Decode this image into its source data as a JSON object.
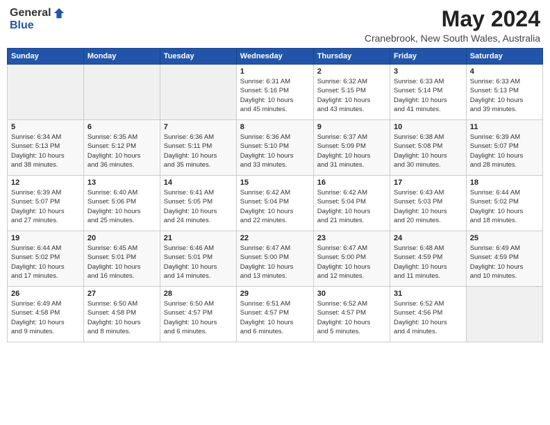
{
  "header": {
    "logo_general": "General",
    "logo_blue": "Blue",
    "month_title": "May 2024",
    "location": "Cranebrook, New South Wales, Australia"
  },
  "days_of_week": [
    "Sunday",
    "Monday",
    "Tuesday",
    "Wednesday",
    "Thursday",
    "Friday",
    "Saturday"
  ],
  "weeks": [
    [
      {
        "day": "",
        "info": ""
      },
      {
        "day": "",
        "info": ""
      },
      {
        "day": "",
        "info": ""
      },
      {
        "day": "1",
        "info": "Sunrise: 6:31 AM\nSunset: 5:16 PM\nDaylight: 10 hours\nand 45 minutes."
      },
      {
        "day": "2",
        "info": "Sunrise: 6:32 AM\nSunset: 5:15 PM\nDaylight: 10 hours\nand 43 minutes."
      },
      {
        "day": "3",
        "info": "Sunrise: 6:33 AM\nSunset: 5:14 PM\nDaylight: 10 hours\nand 41 minutes."
      },
      {
        "day": "4",
        "info": "Sunrise: 6:33 AM\nSunset: 5:13 PM\nDaylight: 10 hours\nand 39 minutes."
      }
    ],
    [
      {
        "day": "5",
        "info": "Sunrise: 6:34 AM\nSunset: 5:13 PM\nDaylight: 10 hours\nand 38 minutes."
      },
      {
        "day": "6",
        "info": "Sunrise: 6:35 AM\nSunset: 5:12 PM\nDaylight: 10 hours\nand 36 minutes."
      },
      {
        "day": "7",
        "info": "Sunrise: 6:36 AM\nSunset: 5:11 PM\nDaylight: 10 hours\nand 35 minutes."
      },
      {
        "day": "8",
        "info": "Sunrise: 6:36 AM\nSunset: 5:10 PM\nDaylight: 10 hours\nand 33 minutes."
      },
      {
        "day": "9",
        "info": "Sunrise: 6:37 AM\nSunset: 5:09 PM\nDaylight: 10 hours\nand 31 minutes."
      },
      {
        "day": "10",
        "info": "Sunrise: 6:38 AM\nSunset: 5:08 PM\nDaylight: 10 hours\nand 30 minutes."
      },
      {
        "day": "11",
        "info": "Sunrise: 6:39 AM\nSunset: 5:07 PM\nDaylight: 10 hours\nand 28 minutes."
      }
    ],
    [
      {
        "day": "12",
        "info": "Sunrise: 6:39 AM\nSunset: 5:07 PM\nDaylight: 10 hours\nand 27 minutes."
      },
      {
        "day": "13",
        "info": "Sunrise: 6:40 AM\nSunset: 5:06 PM\nDaylight: 10 hours\nand 25 minutes."
      },
      {
        "day": "14",
        "info": "Sunrise: 6:41 AM\nSunset: 5:05 PM\nDaylight: 10 hours\nand 24 minutes."
      },
      {
        "day": "15",
        "info": "Sunrise: 6:42 AM\nSunset: 5:04 PM\nDaylight: 10 hours\nand 22 minutes."
      },
      {
        "day": "16",
        "info": "Sunrise: 6:42 AM\nSunset: 5:04 PM\nDaylight: 10 hours\nand 21 minutes."
      },
      {
        "day": "17",
        "info": "Sunrise: 6:43 AM\nSunset: 5:03 PM\nDaylight: 10 hours\nand 20 minutes."
      },
      {
        "day": "18",
        "info": "Sunrise: 6:44 AM\nSunset: 5:02 PM\nDaylight: 10 hours\nand 18 minutes."
      }
    ],
    [
      {
        "day": "19",
        "info": "Sunrise: 6:44 AM\nSunset: 5:02 PM\nDaylight: 10 hours\nand 17 minutes."
      },
      {
        "day": "20",
        "info": "Sunrise: 6:45 AM\nSunset: 5:01 PM\nDaylight: 10 hours\nand 16 minutes."
      },
      {
        "day": "21",
        "info": "Sunrise: 6:46 AM\nSunset: 5:01 PM\nDaylight: 10 hours\nand 14 minutes."
      },
      {
        "day": "22",
        "info": "Sunrise: 6:47 AM\nSunset: 5:00 PM\nDaylight: 10 hours\nand 13 minutes."
      },
      {
        "day": "23",
        "info": "Sunrise: 6:47 AM\nSunset: 5:00 PM\nDaylight: 10 hours\nand 12 minutes."
      },
      {
        "day": "24",
        "info": "Sunrise: 6:48 AM\nSunset: 4:59 PM\nDaylight: 10 hours\nand 11 minutes."
      },
      {
        "day": "25",
        "info": "Sunrise: 6:49 AM\nSunset: 4:59 PM\nDaylight: 10 hours\nand 10 minutes."
      }
    ],
    [
      {
        "day": "26",
        "info": "Sunrise: 6:49 AM\nSunset: 4:58 PM\nDaylight: 10 hours\nand 9 minutes."
      },
      {
        "day": "27",
        "info": "Sunrise: 6:50 AM\nSunset: 4:58 PM\nDaylight: 10 hours\nand 8 minutes."
      },
      {
        "day": "28",
        "info": "Sunrise: 6:50 AM\nSunset: 4:57 PM\nDaylight: 10 hours\nand 6 minutes."
      },
      {
        "day": "29",
        "info": "Sunrise: 6:51 AM\nSunset: 4:57 PM\nDaylight: 10 hours\nand 6 minutes."
      },
      {
        "day": "30",
        "info": "Sunrise: 6:52 AM\nSunset: 4:57 PM\nDaylight: 10 hours\nand 5 minutes."
      },
      {
        "day": "31",
        "info": "Sunrise: 6:52 AM\nSunset: 4:56 PM\nDaylight: 10 hours\nand 4 minutes."
      },
      {
        "day": "",
        "info": ""
      }
    ]
  ]
}
